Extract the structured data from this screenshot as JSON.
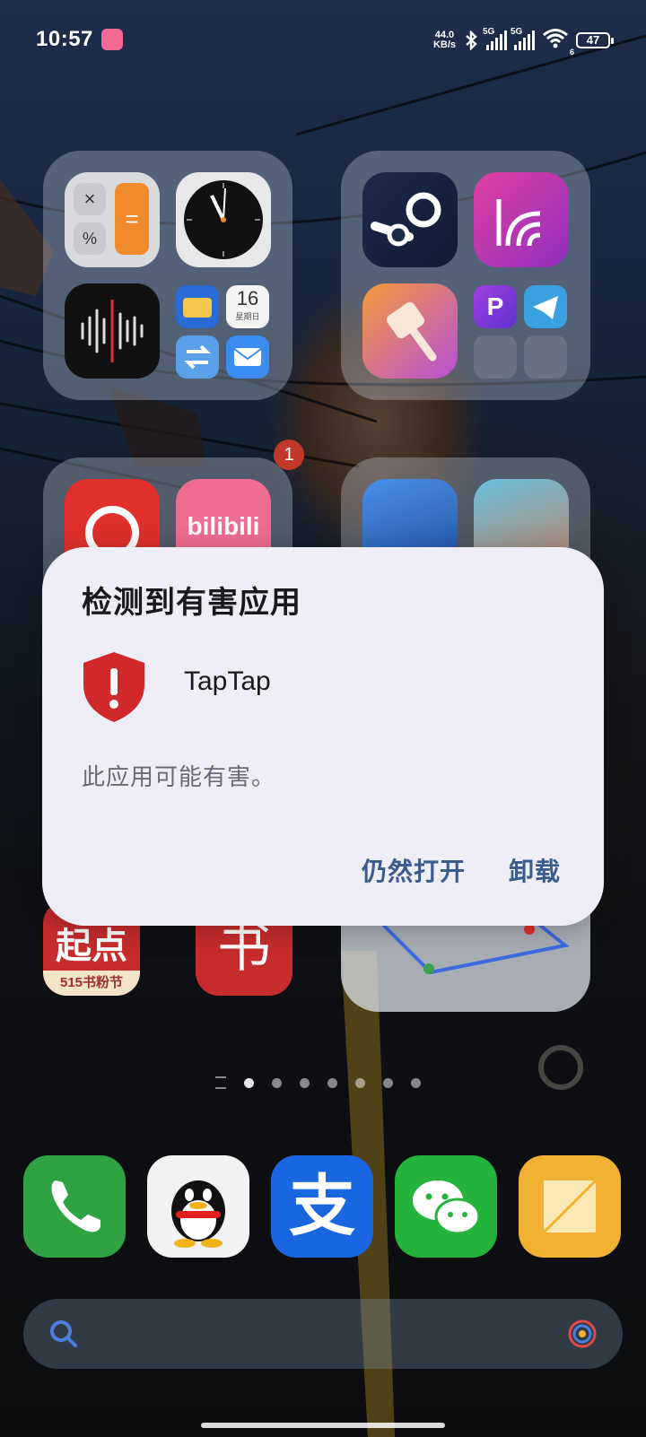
{
  "status_bar": {
    "time": "10:57",
    "net_speed_value": "44.0",
    "net_speed_unit": "KB/s",
    "sim1_label": "5G",
    "sim2_label": "5G",
    "wifi_label": "6",
    "battery": "47"
  },
  "folders": [
    {
      "apps": [
        "calculator-icon",
        "clock-icon",
        "voice-memos-icon",
        "wallet-icon",
        "calendar-icon",
        "transfer-icon",
        "mail-icon"
      ],
      "calendar_day": "16",
      "calendar_weekday": "星期日"
    },
    {
      "apps": [
        "steam-icon",
        "vpn-pro-icon",
        "cleaner-icon",
        "p-app-icon",
        "telegram-icon"
      ]
    },
    {
      "apps": [
        "netease-music-icon",
        "bilibili-icon"
      ],
      "badge": "1"
    },
    {
      "apps": [
        "game-penguin-icon",
        "game-anime-girl-icon"
      ]
    }
  ],
  "home_apps": {
    "qidian_label": "起点",
    "qidian_sub": "515书粉节",
    "shu_label": "书"
  },
  "dock": [
    "phone-icon",
    "qq-icon",
    "alipay-icon",
    "wechat-icon",
    "notes-icon"
  ],
  "alipay_char": "支",
  "dialog": {
    "title": "检测到有害应用",
    "app_name": "TapTap",
    "message": "此应用可能有害。",
    "open_anyway": "仍然打开",
    "uninstall": "卸载"
  },
  "colors": {
    "dialog_bg": "#efeef6",
    "button_text": "#3b5b8c",
    "shield_red": "#d0282b"
  }
}
